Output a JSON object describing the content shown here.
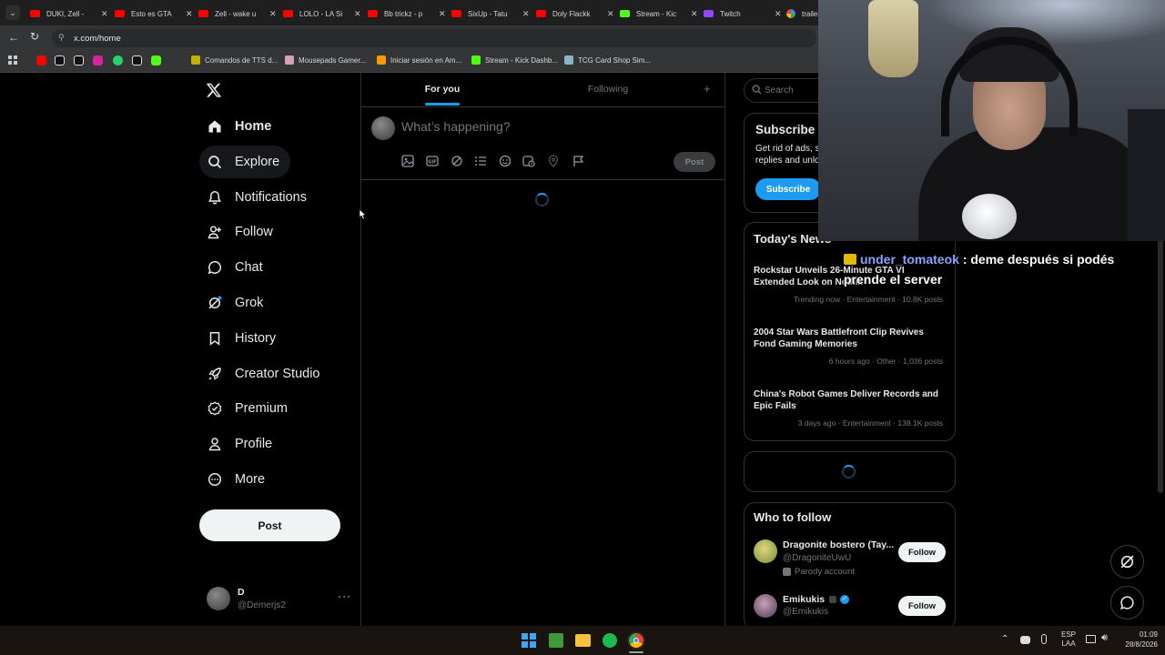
{
  "browser": {
    "tabs": [
      {
        "title": "DUKI, Zell -",
        "icon": "youtube-icon",
        "color": "#ff0000"
      },
      {
        "title": "Esto es GTA",
        "icon": "youtube-icon",
        "color": "#ff0000"
      },
      {
        "title": "Zell - wake u",
        "icon": "youtube-icon",
        "color": "#ff0000"
      },
      {
        "title": "LOLO - LA Si",
        "icon": "youtube-icon",
        "color": "#ff0000"
      },
      {
        "title": "Bb trickz - p",
        "icon": "youtube-icon",
        "color": "#ff0000"
      },
      {
        "title": "SixUp - Tatu",
        "icon": "youtube-icon",
        "color": "#ff0000"
      },
      {
        "title": "Doly Flackk",
        "icon": "youtube-icon",
        "color": "#ff0000"
      },
      {
        "title": "Stream - Kic",
        "icon": "kick-icon",
        "color": "#53fc18"
      },
      {
        "title": "Twitch",
        "icon": "twitch-icon",
        "color": "#9146ff"
      },
      {
        "title": "trailer",
        "icon": "google-icon",
        "color": "#ffffff"
      }
    ],
    "url": "x.com/home",
    "bookmarks": [
      {
        "label": "Comandos de TTS d...",
        "color": "#c4b000"
      },
      {
        "label": "Mousepads Gamer...",
        "color": "#d9a0b8"
      },
      {
        "label": "Iniciar sesión en Am...",
        "color": "#ff9900"
      },
      {
        "label": "Stream - Kick Dashb...",
        "color": "#53fc18"
      },
      {
        "label": "TCG Card Shop Sim...",
        "color": "#8ab4c8"
      }
    ],
    "bookmark_icons": [
      "youtube-icon",
      "x-icon",
      "tiktok-icon",
      "instagram-icon",
      "whatsapp-icon",
      "threads-icon",
      "kick-icon"
    ]
  },
  "sidebar": {
    "items": [
      {
        "label": "Home",
        "icon": "home-icon"
      },
      {
        "label": "Explore",
        "icon": "search-icon"
      },
      {
        "label": "Notifications",
        "icon": "bell-icon"
      },
      {
        "label": "Follow",
        "icon": "person-add-icon"
      },
      {
        "label": "Chat",
        "icon": "chat-icon"
      },
      {
        "label": "Grok",
        "icon": "grok-icon"
      },
      {
        "label": "History",
        "icon": "bookmark-icon"
      },
      {
        "label": "Creator Studio",
        "icon": "rocket-icon"
      },
      {
        "label": "Premium",
        "icon": "premium-icon"
      },
      {
        "label": "Profile",
        "icon": "person-icon"
      },
      {
        "label": "More",
        "icon": "more-circle-icon"
      }
    ],
    "post_button": "Post",
    "account": {
      "name": "D",
      "handle": "@Demerjs2"
    }
  },
  "feed": {
    "tabs": [
      "For you",
      "Following"
    ],
    "composer_placeholder": "What’s happening?",
    "post_button": "Post"
  },
  "right": {
    "search_placeholder": "Search",
    "subscribe": {
      "title": "Subscribe",
      "text_line1": "Get rid of ads, s",
      "text_line2": "replies and unlo",
      "button": "Subscribe"
    },
    "news": {
      "title": "Today's News",
      "items": [
        {
          "headline": "Rockstar Unveils 26-Minute GTA VI Extended Look on Netflix",
          "meta": "Trending now · Entertainment · 10.8K posts"
        },
        {
          "headline": "2004 Star Wars Battlefront Clip Revives Fond Gaming Memories",
          "meta": "6 hours ago · Other · 1,036 posts"
        },
        {
          "headline": "China's Robot Games Deliver Records and Epic Fails",
          "meta": "3 days ago · Entertainment · 138.1K posts"
        }
      ]
    },
    "who_to_follow": {
      "title": "Who to follow",
      "users": [
        {
          "name": "Dragonite bostero (Tay...",
          "handle": "@DragoniteUwU",
          "badge": "Parody account",
          "button": "Follow"
        },
        {
          "name": "Emikukis",
          "handle": "@Emikukis",
          "button": "Follow"
        }
      ]
    }
  },
  "overlay": {
    "chat_user": "under_tomateok",
    "chat_message_line1": ": deme después si podés",
    "chat_message_line2": "prende el server",
    "user_color": "#8aa2ff"
  },
  "taskbar": {
    "lang": "ESP",
    "lang2": "LAA",
    "time": "01:09",
    "date": "28/8/2026"
  },
  "colors": {
    "accent": "#1d9bf0",
    "bg": "#000000",
    "border": "#2f3336",
    "muted": "#71767b"
  }
}
